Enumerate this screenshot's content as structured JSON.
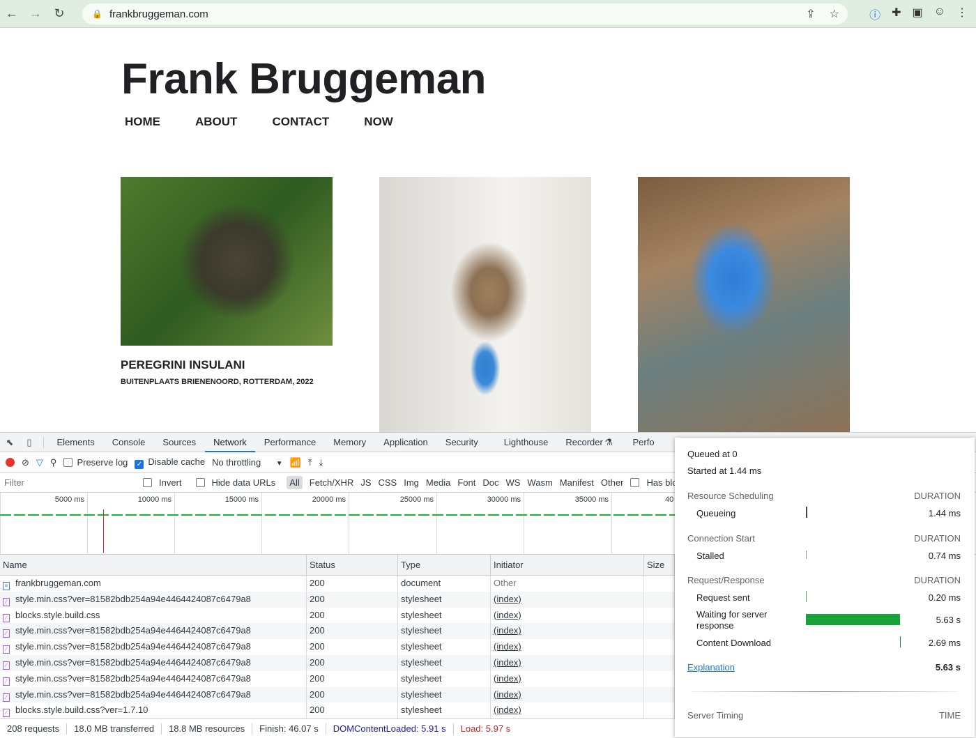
{
  "browser": {
    "url": "frankbruggeman.com"
  },
  "site": {
    "title": "Frank Bruggeman",
    "nav": [
      "HOME",
      "ABOUT",
      "CONTACT",
      "NOW"
    ],
    "caption_title": "PEREGRINI INSULANI",
    "caption_sub": "BUITENPLAATS BRIENENOORD, ROTTERDAM, 2022"
  },
  "devtools": {
    "tabs": [
      "Elements",
      "Console",
      "Sources",
      "Network",
      "Performance",
      "Memory",
      "Application",
      "Security",
      "Lighthouse",
      "Recorder",
      "Perfo"
    ],
    "active_tab": "Network",
    "toolbar": {
      "preserve_log": "Preserve log",
      "disable_cache": "Disable cache",
      "throttling": "No throttling"
    },
    "filter": {
      "placeholder": "Filter",
      "invert": "Invert",
      "hide_data_urls": "Hide data URLs",
      "types": [
        "All",
        "Fetch/XHR",
        "JS",
        "CSS",
        "Img",
        "Media",
        "Font",
        "Doc",
        "WS",
        "Wasm",
        "Manifest",
        "Other"
      ],
      "has_blocked": "Has block"
    },
    "overview_ticks": [
      "5000 ms",
      "10000 ms",
      "15000 ms",
      "20000 ms",
      "25000 ms",
      "30000 ms",
      "35000 ms",
      "40"
    ],
    "columns": [
      "Name",
      "Status",
      "Type",
      "Initiator",
      "Size"
    ],
    "rows": [
      {
        "name": "frankbruggeman.com",
        "status": "200",
        "type": "document",
        "initiator": "Other",
        "icon": "document"
      },
      {
        "name": "style.min.css?ver=81582bdb254a94e4464424087c6479a8",
        "status": "200",
        "type": "stylesheet",
        "initiator": "(index)",
        "icon": "stylesheet"
      },
      {
        "name": "blocks.style.build.css",
        "status": "200",
        "type": "stylesheet",
        "initiator": "(index)",
        "icon": "stylesheet"
      },
      {
        "name": "style.min.css?ver=81582bdb254a94e4464424087c6479a8",
        "status": "200",
        "type": "stylesheet",
        "initiator": "(index)",
        "icon": "stylesheet"
      },
      {
        "name": "style.min.css?ver=81582bdb254a94e4464424087c6479a8",
        "status": "200",
        "type": "stylesheet",
        "initiator": "(index)",
        "icon": "stylesheet"
      },
      {
        "name": "style.min.css?ver=81582bdb254a94e4464424087c6479a8",
        "status": "200",
        "type": "stylesheet",
        "initiator": "(index)",
        "icon": "stylesheet"
      },
      {
        "name": "style.min.css?ver=81582bdb254a94e4464424087c6479a8",
        "status": "200",
        "type": "stylesheet",
        "initiator": "(index)",
        "icon": "stylesheet"
      },
      {
        "name": "style.min.css?ver=81582bdb254a94e4464424087c6479a8",
        "status": "200",
        "type": "stylesheet",
        "initiator": "(index)",
        "icon": "stylesheet"
      },
      {
        "name": "blocks.style.build.css?ver=1.7.10",
        "status": "200",
        "type": "stylesheet",
        "initiator": "(index)",
        "icon": "stylesheet"
      }
    ],
    "status": {
      "requests": "208 requests",
      "transferred": "18.0 MB transferred",
      "resources": "18.8 MB resources",
      "finish": "Finish: 46.07 s",
      "dcl": "DOMContentLoaded: 5.91 s",
      "load": "Load: 5.97 s"
    },
    "colors": {
      "dcl": "#1a1aa6",
      "load": "#c5221f",
      "accent": "#1a73e8",
      "waiting_bar": "#1aa33a"
    }
  },
  "timing": {
    "queued": "Queued at 0",
    "started": "Started at 1.44 ms",
    "sections": [
      {
        "title": "Resource Scheduling",
        "col": "DURATION",
        "items": [
          {
            "label": "Queueing",
            "value": "1.44 ms"
          }
        ]
      },
      {
        "title": "Connection Start",
        "col": "DURATION",
        "items": [
          {
            "label": "Stalled",
            "value": "0.74 ms"
          }
        ]
      },
      {
        "title": "Request/Response",
        "col": "DURATION",
        "items": [
          {
            "label": "Request sent",
            "value": "0.20 ms"
          },
          {
            "label": "Waiting for server response",
            "value": "5.63 s"
          },
          {
            "label": "Content Download",
            "value": "2.69 ms"
          }
        ]
      }
    ],
    "explanation": "Explanation",
    "total": "5.63 s",
    "server_timing": "Server Timing",
    "server_col": "TIME"
  }
}
